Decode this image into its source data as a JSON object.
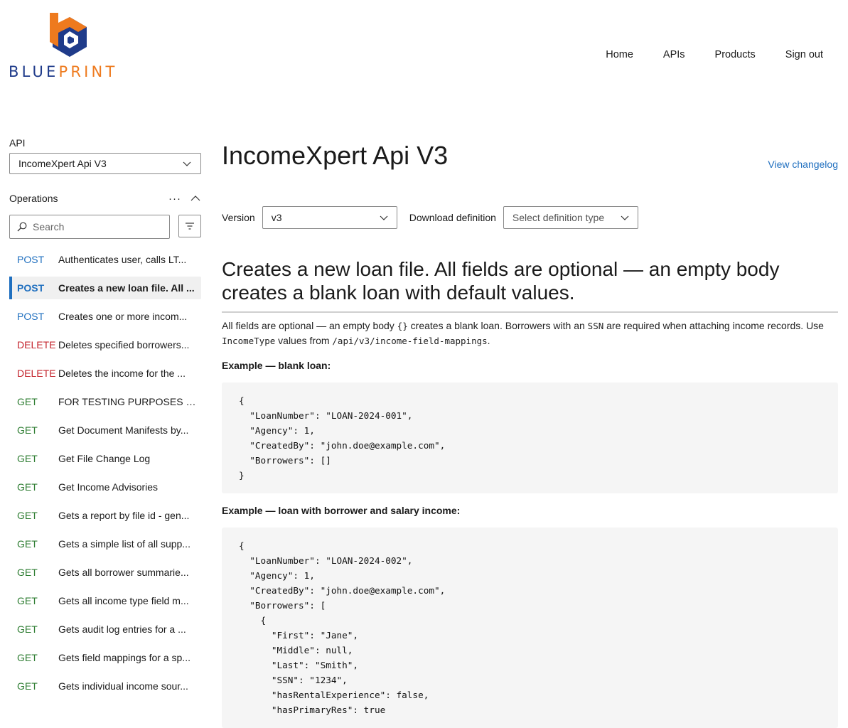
{
  "brand": {
    "part1": "BLUE",
    "part2": "PRINT",
    "blue": "#1f3b8a",
    "orange": "#ee7a1e"
  },
  "nav": {
    "items": [
      "Home",
      "APIs",
      "Products",
      "Sign out"
    ]
  },
  "sidebar": {
    "api_label": "API",
    "api_selected": "IncomeXpert Api V3",
    "operations_label": "Operations",
    "more": "···",
    "search_placeholder": "Search",
    "operations": [
      {
        "method": "POST",
        "name": "Authenticates user, calls LT..."
      },
      {
        "method": "POST",
        "name": "Creates a new loan file. All ..."
      },
      {
        "method": "POST",
        "name": "Creates one or more incom..."
      },
      {
        "method": "DELETE",
        "name": "Deletes specified borrowers..."
      },
      {
        "method": "DELETE",
        "name": "Deletes the income for the ..."
      },
      {
        "method": "GET",
        "name": "FOR TESTING PURPOSES O..."
      },
      {
        "method": "GET",
        "name": "Get Document Manifests by..."
      },
      {
        "method": "GET",
        "name": "Get File Change Log"
      },
      {
        "method": "GET",
        "name": "Get Income Advisories"
      },
      {
        "method": "GET",
        "name": "Gets a report by file id - gen..."
      },
      {
        "method": "GET",
        "name": "Gets a simple list of all supp..."
      },
      {
        "method": "GET",
        "name": "Gets all borrower summarie..."
      },
      {
        "method": "GET",
        "name": "Gets all income type field m..."
      },
      {
        "method": "GET",
        "name": "Gets audit log entries for a ..."
      },
      {
        "method": "GET",
        "name": "Gets field mappings for a sp..."
      },
      {
        "method": "GET",
        "name": "Gets individual income sour..."
      }
    ],
    "method_colors": {
      "POST": "#1f6fbf",
      "DELETE": "#c4262e",
      "GET": "#2e7d32"
    }
  },
  "main": {
    "title": "IncomeXpert Api V3",
    "changelog": "View changelog",
    "version_label": "Version",
    "version_value": "v3",
    "download_label": "Download definition",
    "download_placeholder": "Select definition type",
    "op_title": "Creates a new loan file. All fields are optional — an empty body creates a blank loan with default values.",
    "desc": {
      "t1": "All fields are optional — an empty body ",
      "c1": "{}",
      "t2": " creates a blank loan. Borrowers with an ",
      "c2": "SSN",
      "t3": " are required when attaching income records. Use ",
      "c3": "IncomeType",
      "t4": " values from ",
      "c4": "/api/v3/income-field-mappings",
      "t5": "."
    },
    "example1_label": "Example — blank loan:",
    "example1_code": "{\n  \"LoanNumber\": \"LOAN-2024-001\",\n  \"Agency\": 1,\n  \"CreatedBy\": \"john.doe@example.com\",\n  \"Borrowers\": []\n}",
    "example2_label": "Example — loan with borrower and salary income:",
    "example2_code": "{\n  \"LoanNumber\": \"LOAN-2024-002\",\n  \"Agency\": 1,\n  \"CreatedBy\": \"john.doe@example.com\",\n  \"Borrowers\": [\n    {\n      \"First\": \"Jane\",\n      \"Middle\": null,\n      \"Last\": \"Smith\",\n      \"SSN\": \"1234\",\n      \"hasRentalExperience\": false,\n      \"hasPrimaryRes\": true"
  }
}
